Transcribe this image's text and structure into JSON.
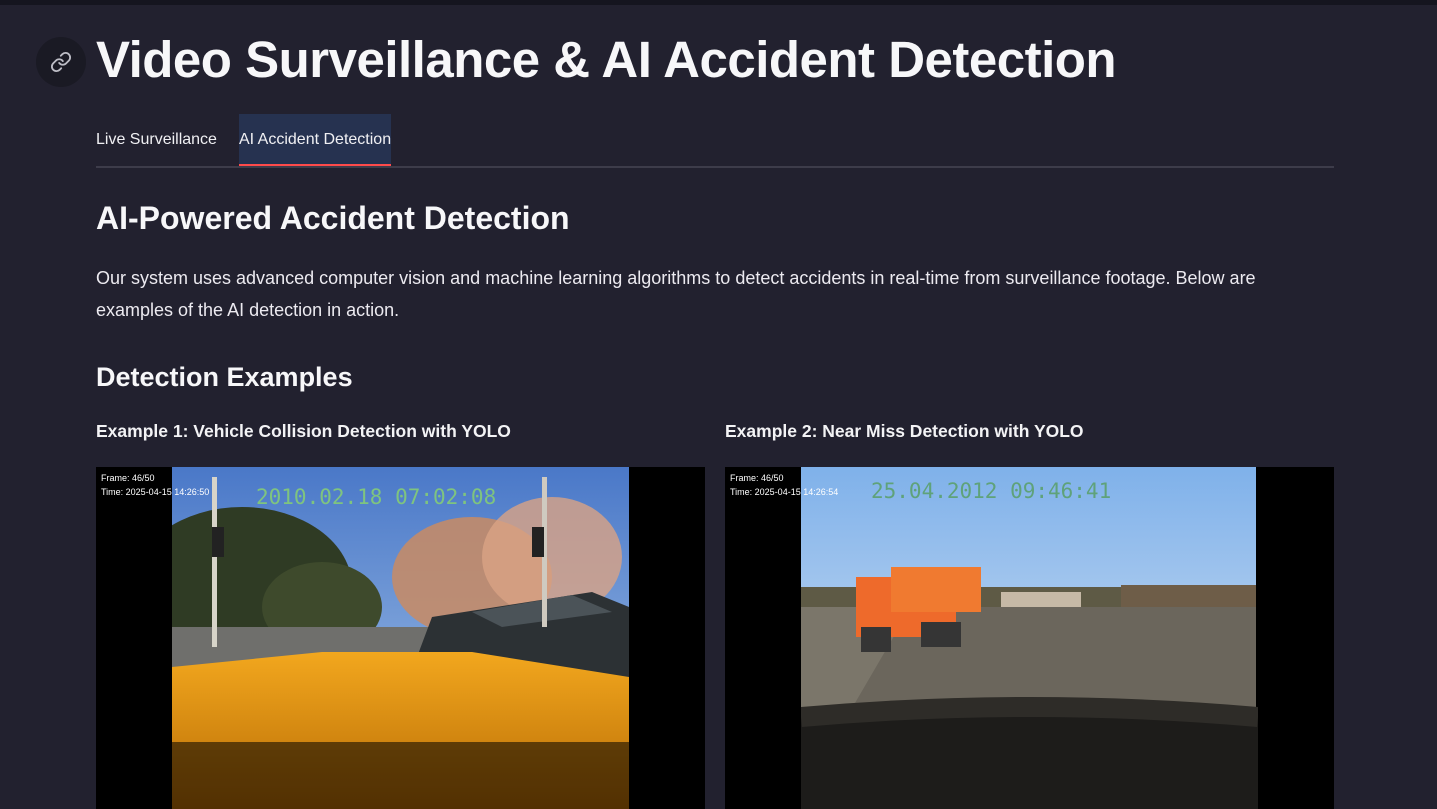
{
  "header": {
    "title": "Video Surveillance & AI Accident Detection",
    "link_icon": "link-icon"
  },
  "tabs": [
    {
      "label": "Live Surveillance",
      "active": false
    },
    {
      "label": "AI Accident Detection",
      "active": true
    }
  ],
  "main": {
    "heading": "AI-Powered Accident Detection",
    "description": "Our system uses advanced computer vision and machine learning algorithms to detect accidents in real-time from surveillance footage. Below are examples of the AI detection in action.",
    "examples_heading": "Detection Examples",
    "examples": [
      {
        "label": "Example 1: Vehicle Collision Detection with YOLO",
        "frame": "Frame: 46/50",
        "time": "Time: 2025-04-15 14:26:50",
        "video_timestamp": "2010.02.18 07:02:08"
      },
      {
        "label": "Example 2: Near Miss Detection with YOLO",
        "frame": "Frame: 46/50",
        "time": "Time: 2025-04-15 14:26:54",
        "video_timestamp": "25.04.2012 09:46:41"
      }
    ]
  },
  "colors": {
    "accent": "#ff4b4b",
    "background": "#22212f",
    "active_tab_bg": "#263250"
  }
}
